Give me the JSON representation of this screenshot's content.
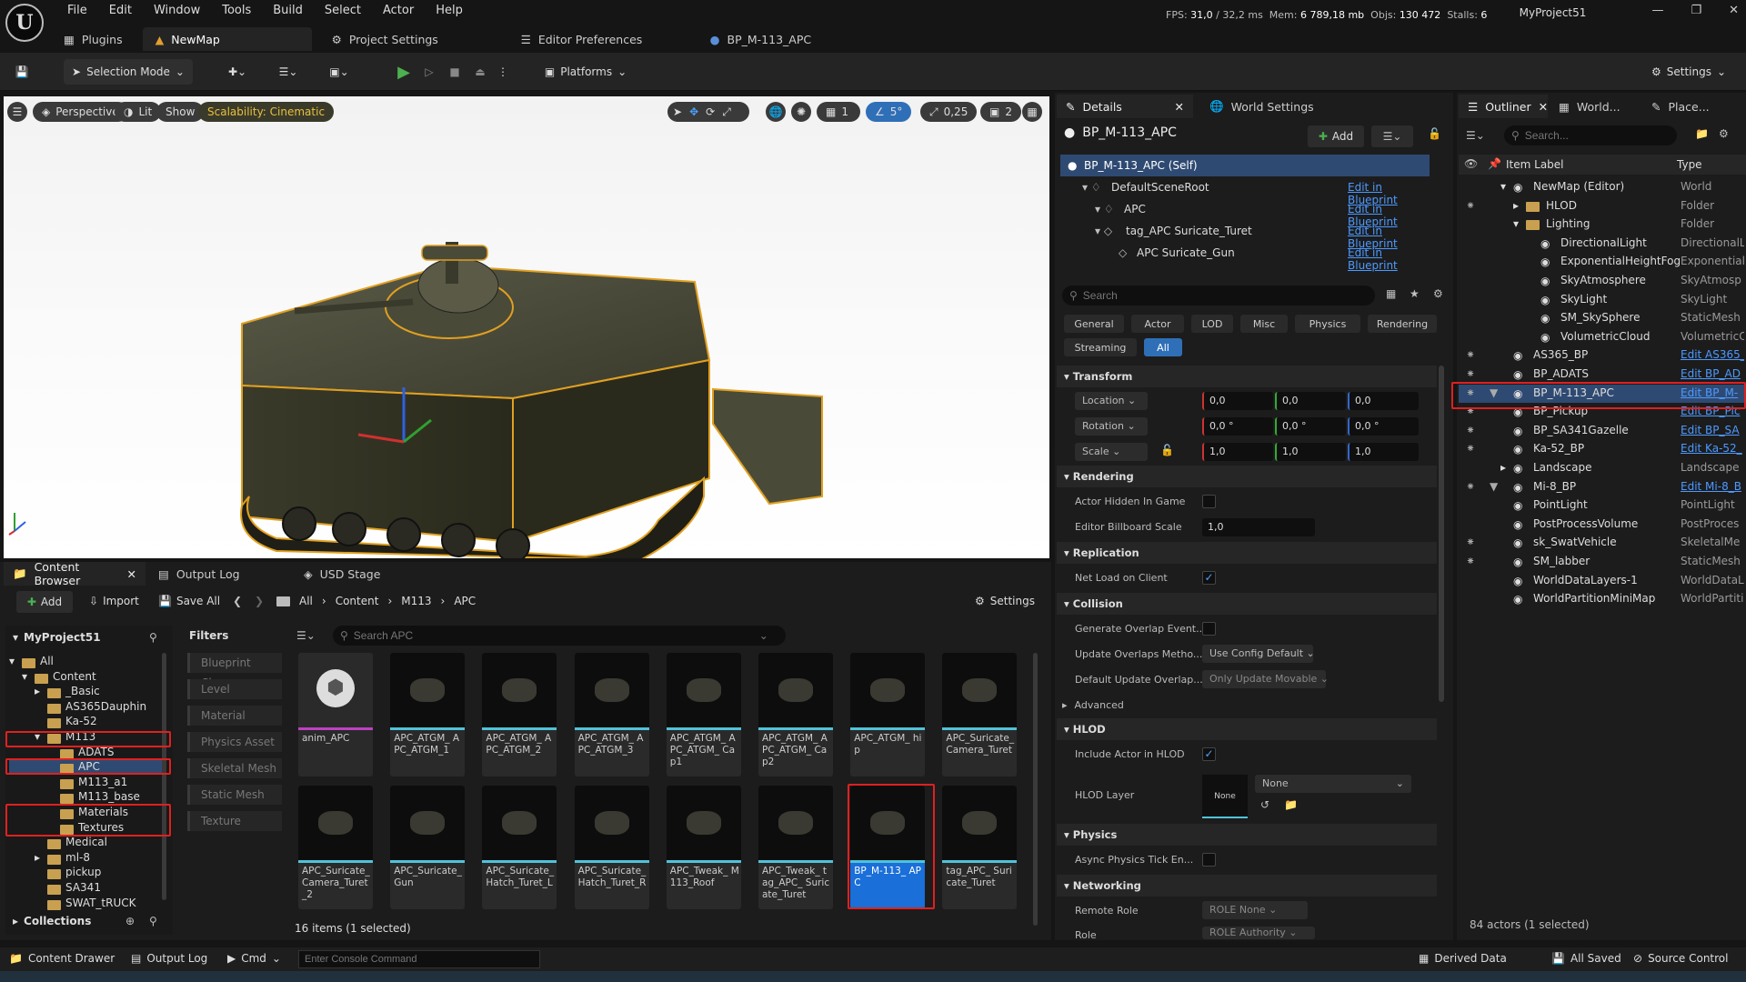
{
  "menu": [
    "File",
    "Edit",
    "Window",
    "Tools",
    "Build",
    "Select",
    "Actor",
    "Help"
  ],
  "perf": {
    "fps": "FPS:",
    "fps_val": "31,0",
    "ms": "/ 32,2 ms",
    "mem": "Mem:",
    "mem_val": "6 789,18 mb",
    "objs": "Objs:",
    "objs_val": "130 472",
    "stalls": "Stalls:",
    "stalls_val": "6"
  },
  "project_name": "MyProject51",
  "doc_tabs": [
    "Plugins",
    "NewMap",
    "Project Settings",
    "Editor Preferences",
    "BP_M-113_APC"
  ],
  "toolbar": {
    "selection_mode": "Selection Mode",
    "platforms": "Platforms",
    "settings": "Settings"
  },
  "viewport": {
    "perspective": "Perspective",
    "lit": "Lit",
    "show": "Show",
    "scalability": "Scalability: Cinematic",
    "grid": "1",
    "angle": "5°",
    "scale": "0,25",
    "camera": "2"
  },
  "details": {
    "tab": "Details",
    "world_tab": "World Settings",
    "actor": "BP_M-113_APC",
    "add": "Add",
    "components": [
      {
        "name": "BP_M-113_APC (Self)",
        "link": ""
      },
      {
        "name": "DefaultSceneRoot",
        "link": "Edit in Blueprint"
      },
      {
        "name": "APC",
        "link": "Edit in Blueprint"
      },
      {
        "name": "tag_APC Suricate_Turet",
        "link": "Edit in Blueprint"
      },
      {
        "name": "APC Suricate_Gun",
        "link": "Edit in Blueprint"
      }
    ],
    "search_placeholder": "Search",
    "filters": [
      "General",
      "Actor",
      "LOD",
      "Misc",
      "Physics",
      "Rendering",
      "Streaming",
      "All"
    ],
    "transform": "Transform",
    "location": "Location",
    "rotation": "Rotation",
    "scale": "Scale",
    "loc": [
      "0,0",
      "0,0",
      "0,0"
    ],
    "rot": [
      "0,0 °",
      "0,0 °",
      "0,0 °"
    ],
    "scl": [
      "1,0",
      "1,0",
      "1,0"
    ],
    "rendering": "Rendering",
    "actor_hidden": "Actor Hidden In Game",
    "billboard": "Editor Billboard Scale",
    "billboard_val": "1,0",
    "replication": "Replication",
    "net_load": "Net Load on Client",
    "collision": "Collision",
    "gen_overlap": "Generate Overlap Event...",
    "update_overlaps": "Update Overlaps Metho...",
    "update_overlaps_val": "Use Config Default",
    "default_update": "Default Update Overlap...",
    "default_update_val": "Only Update Movable",
    "advanced": "Advanced",
    "hlod": "HLOD",
    "include_hlod": "Include Actor in HLOD",
    "hlod_layer": "HLOD Layer",
    "hlod_none": "None",
    "hlod_combo": "None",
    "physics": "Physics",
    "async_physics": "Async Physics Tick En...",
    "networking": "Networking",
    "remote_role": "Remote Role",
    "remote_role_val": "ROLE None",
    "role": "Role",
    "role_val": "ROLE Authority"
  },
  "outliner": {
    "tabs": [
      "Outliner",
      "World...",
      "Place..."
    ],
    "search_placeholder": "Search...",
    "col_label": "Item Label",
    "col_type": "Type",
    "items": [
      {
        "label": "NewMap (Editor)",
        "type": "World"
      },
      {
        "label": "HLOD",
        "type": "Folder"
      },
      {
        "label": "Lighting",
        "type": "Folder"
      },
      {
        "label": "DirectionalLight",
        "type": "DirectionalL"
      },
      {
        "label": "ExponentialHeightFog",
        "type": "Exponential"
      },
      {
        "label": "SkyAtmosphere",
        "type": "SkyAtmosp"
      },
      {
        "label": "SkyLight",
        "type": "SkyLight"
      },
      {
        "label": "SM_SkySphere",
        "type": "StaticMesh"
      },
      {
        "label": "VolumetricCloud",
        "type": "VolumetricC"
      },
      {
        "label": "AS365_BP",
        "type": "Edit AS365_"
      },
      {
        "label": "BP_ADATS",
        "type": "Edit BP_AD"
      },
      {
        "label": "BP_M-113_APC",
        "type": "Edit BP_M-"
      },
      {
        "label": "BP_Pickup",
        "type": "Edit BP_Pic"
      },
      {
        "label": "BP_SA341Gazelle",
        "type": "Edit BP_SA"
      },
      {
        "label": "Ka-52_BP",
        "type": "Edit Ka-52_"
      },
      {
        "label": "Landscape",
        "type": "Landscape"
      },
      {
        "label": "Mi-8_BP",
        "type": "Edit Mi-8_B"
      },
      {
        "label": "PointLight",
        "type": "PointLight"
      },
      {
        "label": "PostProcessVolume",
        "type": "PostProces"
      },
      {
        "label": "sk_SwatVehicle",
        "type": "SkeletalMe"
      },
      {
        "label": "SM_labber",
        "type": "StaticMesh"
      },
      {
        "label": "WorldDataLayers-1",
        "type": "WorldDataL"
      },
      {
        "label": "WorldPartitionMiniMap",
        "type": "WorldPartiti"
      }
    ],
    "footer": "84 actors (1 selected)"
  },
  "content_browser": {
    "tabs": [
      "Content Browser",
      "Output Log",
      "USD Stage"
    ],
    "add": "Add",
    "import": "Import",
    "save_all": "Save All",
    "path": [
      "All",
      "Content",
      "M113",
      "APC"
    ],
    "settings": "Settings",
    "project": "MyProject51",
    "tree": [
      "All",
      "Content",
      "_Basic",
      "AS365Dauphin",
      "Ka-52",
      "M113",
      "ADATS",
      "APC",
      "M113_a1",
      "M113_base",
      "Materials",
      "Textures",
      "Medical",
      "ml-8",
      "pickup",
      "SA341",
      "SWAT_tRUCK"
    ],
    "collections": "Collections",
    "filters_title": "Filters",
    "filters": [
      "Blueprint Class",
      "Level",
      "Material",
      "Physics Asset",
      "Skeletal Mesh",
      "Static Mesh",
      "Texture"
    ],
    "search_placeholder": "Search APC",
    "assets": [
      "anim_APC",
      "APC_ATGM_ APC_ATGM_1",
      "APC_ATGM_ APC_ATGM_2",
      "APC_ATGM_ APC_ATGM_3",
      "APC_ATGM_ APC_ATGM_ Cap1",
      "APC_ATGM_ APC_ATGM_ Cap2",
      "APC_ATGM_ hip",
      "APC_Suricate_ Camera_Turet",
      "APC_Suricate_ Camera_Turet _2",
      "APC_Suricate_ Gun",
      "APC_Suricate_ Hatch_Turet_L",
      "APC_Suricate_ Hatch_Turet_R",
      "APC_Tweak_ M113_Roof",
      "APC_Tweak_ tag_APC_ Suricate_Turet",
      "BP_M-113_ APC",
      "tag_APC_ Suricate_Turet"
    ],
    "count": "16 items (1 selected)"
  },
  "status": {
    "content_drawer": "Content Drawer",
    "output_log": "Output Log",
    "cmd": "Cmd",
    "console_placeholder": "Enter Console Command",
    "derived": "Derived Data",
    "saved": "All Saved",
    "source": "Source Control"
  }
}
